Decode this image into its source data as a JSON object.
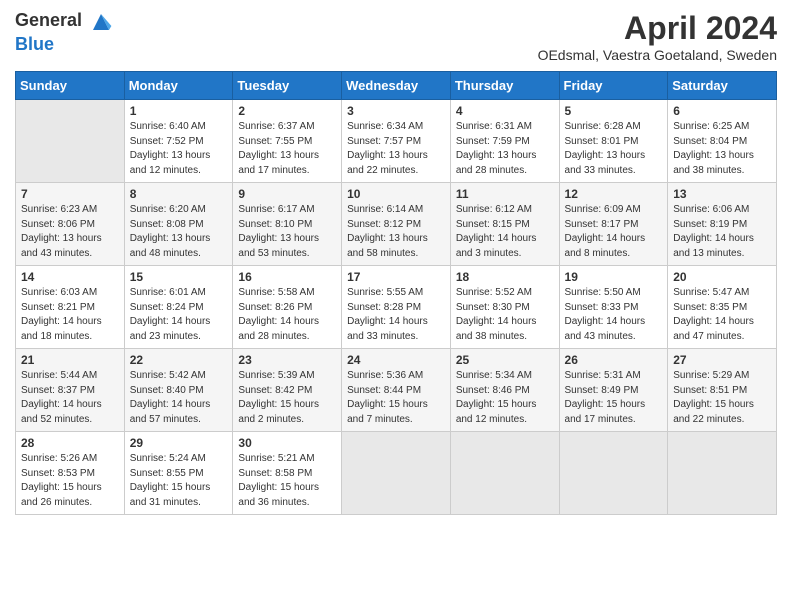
{
  "header": {
    "logo_general": "General",
    "logo_blue": "Blue",
    "month_title": "April 2024",
    "location": "OEdsmal, Vaestra Goetaland, Sweden"
  },
  "weekdays": [
    "Sunday",
    "Monday",
    "Tuesday",
    "Wednesday",
    "Thursday",
    "Friday",
    "Saturday"
  ],
  "rows": [
    [
      {
        "day": "",
        "empty": true
      },
      {
        "day": "1",
        "sunrise": "6:40 AM",
        "sunset": "7:52 PM",
        "daylight": "13 hours and 12 minutes."
      },
      {
        "day": "2",
        "sunrise": "6:37 AM",
        "sunset": "7:55 PM",
        "daylight": "13 hours and 17 minutes."
      },
      {
        "day": "3",
        "sunrise": "6:34 AM",
        "sunset": "7:57 PM",
        "daylight": "13 hours and 22 minutes."
      },
      {
        "day": "4",
        "sunrise": "6:31 AM",
        "sunset": "7:59 PM",
        "daylight": "13 hours and 28 minutes."
      },
      {
        "day": "5",
        "sunrise": "6:28 AM",
        "sunset": "8:01 PM",
        "daylight": "13 hours and 33 minutes."
      },
      {
        "day": "6",
        "sunrise": "6:25 AM",
        "sunset": "8:04 PM",
        "daylight": "13 hours and 38 minutes."
      }
    ],
    [
      {
        "day": "7",
        "sunrise": "6:23 AM",
        "sunset": "8:06 PM",
        "daylight": "13 hours and 43 minutes."
      },
      {
        "day": "8",
        "sunrise": "6:20 AM",
        "sunset": "8:08 PM",
        "daylight": "13 hours and 48 minutes."
      },
      {
        "day": "9",
        "sunrise": "6:17 AM",
        "sunset": "8:10 PM",
        "daylight": "13 hours and 53 minutes."
      },
      {
        "day": "10",
        "sunrise": "6:14 AM",
        "sunset": "8:12 PM",
        "daylight": "13 hours and 58 minutes."
      },
      {
        "day": "11",
        "sunrise": "6:12 AM",
        "sunset": "8:15 PM",
        "daylight": "14 hours and 3 minutes."
      },
      {
        "day": "12",
        "sunrise": "6:09 AM",
        "sunset": "8:17 PM",
        "daylight": "14 hours and 8 minutes."
      },
      {
        "day": "13",
        "sunrise": "6:06 AM",
        "sunset": "8:19 PM",
        "daylight": "14 hours and 13 minutes."
      }
    ],
    [
      {
        "day": "14",
        "sunrise": "6:03 AM",
        "sunset": "8:21 PM",
        "daylight": "14 hours and 18 minutes."
      },
      {
        "day": "15",
        "sunrise": "6:01 AM",
        "sunset": "8:24 PM",
        "daylight": "14 hours and 23 minutes."
      },
      {
        "day": "16",
        "sunrise": "5:58 AM",
        "sunset": "8:26 PM",
        "daylight": "14 hours and 28 minutes."
      },
      {
        "day": "17",
        "sunrise": "5:55 AM",
        "sunset": "8:28 PM",
        "daylight": "14 hours and 33 minutes."
      },
      {
        "day": "18",
        "sunrise": "5:52 AM",
        "sunset": "8:30 PM",
        "daylight": "14 hours and 38 minutes."
      },
      {
        "day": "19",
        "sunrise": "5:50 AM",
        "sunset": "8:33 PM",
        "daylight": "14 hours and 43 minutes."
      },
      {
        "day": "20",
        "sunrise": "5:47 AM",
        "sunset": "8:35 PM",
        "daylight": "14 hours and 47 minutes."
      }
    ],
    [
      {
        "day": "21",
        "sunrise": "5:44 AM",
        "sunset": "8:37 PM",
        "daylight": "14 hours and 52 minutes."
      },
      {
        "day": "22",
        "sunrise": "5:42 AM",
        "sunset": "8:40 PM",
        "daylight": "14 hours and 57 minutes."
      },
      {
        "day": "23",
        "sunrise": "5:39 AM",
        "sunset": "8:42 PM",
        "daylight": "15 hours and 2 minutes."
      },
      {
        "day": "24",
        "sunrise": "5:36 AM",
        "sunset": "8:44 PM",
        "daylight": "15 hours and 7 minutes."
      },
      {
        "day": "25",
        "sunrise": "5:34 AM",
        "sunset": "8:46 PM",
        "daylight": "15 hours and 12 minutes."
      },
      {
        "day": "26",
        "sunrise": "5:31 AM",
        "sunset": "8:49 PM",
        "daylight": "15 hours and 17 minutes."
      },
      {
        "day": "27",
        "sunrise": "5:29 AM",
        "sunset": "8:51 PM",
        "daylight": "15 hours and 22 minutes."
      }
    ],
    [
      {
        "day": "28",
        "sunrise": "5:26 AM",
        "sunset": "8:53 PM",
        "daylight": "15 hours and 26 minutes."
      },
      {
        "day": "29",
        "sunrise": "5:24 AM",
        "sunset": "8:55 PM",
        "daylight": "15 hours and 31 minutes."
      },
      {
        "day": "30",
        "sunrise": "5:21 AM",
        "sunset": "8:58 PM",
        "daylight": "15 hours and 36 minutes."
      },
      {
        "day": "",
        "empty": true
      },
      {
        "day": "",
        "empty": true
      },
      {
        "day": "",
        "empty": true
      },
      {
        "day": "",
        "empty": true
      }
    ]
  ],
  "labels": {
    "sunrise": "Sunrise:",
    "sunset": "Sunset:",
    "daylight": "Daylight:"
  }
}
